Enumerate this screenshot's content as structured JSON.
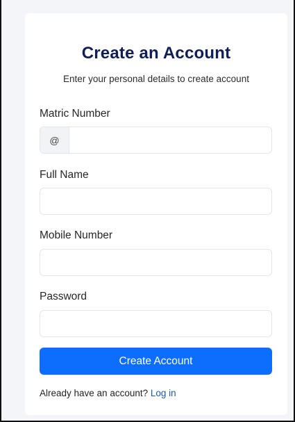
{
  "form": {
    "title": "Create an Account",
    "subtitle": "Enter your personal details to create account",
    "matric": {
      "label": "Matric Number",
      "prefix": "@",
      "value": ""
    },
    "fullname": {
      "label": "Full Name",
      "value": ""
    },
    "mobile": {
      "label": "Mobile Number",
      "value": ""
    },
    "password": {
      "label": "Password",
      "value": ""
    },
    "submit_label": "Create Account",
    "footer_text": "Already have an account? ",
    "login_link": "Log in"
  },
  "colors": {
    "title": "#0f1f55",
    "primary": "#0d6efd",
    "link": "#1a56c6",
    "background": "#f3f5f9"
  }
}
